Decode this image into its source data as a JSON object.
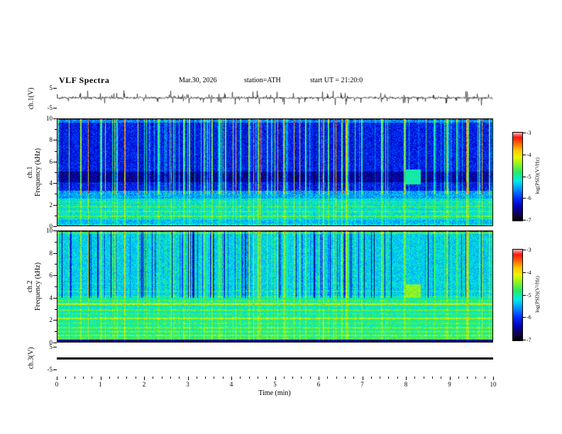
{
  "header": {
    "title": "VLF Spectra",
    "date": "Mar.30, 2026",
    "station": "station=ATH",
    "start_ut": "start UT =  21:20:0"
  },
  "axes": {
    "time": {
      "label": "Time (min)",
      "range": [
        0,
        10
      ],
      "major_ticks": [
        0,
        1,
        2,
        3,
        4,
        5,
        6,
        7,
        8,
        9,
        10
      ]
    },
    "waveform": {
      "label": "ch.1(V)",
      "range": [
        -5,
        5
      ],
      "ticks": [
        5,
        -5
      ]
    },
    "spec1": {
      "label_line1": "ch.1",
      "label_line2": "Frequency (kHz)",
      "range": [
        0,
        10
      ],
      "major_ticks": [
        10,
        8,
        6,
        4,
        2,
        0
      ],
      "minor_ticks": [
        1,
        3,
        5,
        7,
        9
      ]
    },
    "spec2": {
      "label_line1": "ch.2",
      "label_line2": "Frequency (kHz)",
      "range": [
        0,
        10
      ],
      "major_ticks": [
        10,
        8,
        6,
        4,
        2,
        0
      ],
      "minor_ticks": [
        1,
        3,
        5,
        7,
        9
      ]
    },
    "ch3": {
      "label": "ch.3(V)",
      "range": [
        -5,
        5
      ],
      "ticks": [
        5,
        -5
      ]
    }
  },
  "colorbar": {
    "label": "log(PSD)(V²/Hz)",
    "range": [
      -7,
      -3
    ],
    "ticks": [
      -3,
      -4,
      -5,
      -6,
      -7
    ]
  },
  "chart_data": [
    {
      "type": "line",
      "name": "ch1_waveform",
      "ylabel": "ch.1(V)",
      "xlim": [
        0,
        10
      ],
      "ylim": [
        -5,
        5
      ],
      "description": "continuous broadband noise of roughly ±1 V with random impulsive sferic spikes reaching about ±4 V throughout the 10-minute record"
    },
    {
      "type": "heatmap",
      "name": "ch1_spectrogram",
      "xlabel": "Time (min)",
      "ylabel": "ch.1 Frequency (kHz)",
      "xlim": [
        0,
        10
      ],
      "ylim": [
        0,
        10
      ],
      "zlabel": "log(PSD)(V²/Hz)",
      "zlim": [
        -7,
        -3
      ],
      "noise": 0.35,
      "bands": [
        {
          "f": [
            0,
            0.25
          ],
          "level": -6.9
        },
        {
          "f": [
            0.25,
            0.6
          ],
          "level": -5.4
        },
        {
          "f": [
            0.6,
            2.6
          ],
          "level": -5.15
        },
        {
          "f": [
            2.6,
            3.3
          ],
          "level": -5.5
        },
        {
          "f": [
            3.3,
            4.1
          ],
          "level": -6.1
        },
        {
          "f": [
            4.1,
            5.1
          ],
          "level": -6.45
        },
        {
          "f": [
            5.1,
            9.7
          ],
          "level": -6.1
        },
        {
          "f": [
            9.7,
            10
          ],
          "level": -5.6
        }
      ],
      "lines": [
        {
          "f": 0.15,
          "level": -5.0
        },
        {
          "f": 0.9,
          "level": -4.5
        },
        {
          "f": 1.35,
          "level": -4.6
        },
        {
          "f": 1.8,
          "level": -4.7
        },
        {
          "f": 2.25,
          "level": -4.8
        }
      ],
      "texture": {
        "split_f": 3.0,
        "bright_high": 1.05,
        "bright_low": 0.3,
        "dark_high": 0.15,
        "dark_low": 0.05
      },
      "event": {
        "t": [
          8.0,
          8.35
        ],
        "f": [
          3.9,
          5.3
        ],
        "level": -5.0
      },
      "description": "dense vertical sferic streaks (green/yellow) over a blue background above ~3 kHz, darker band 4-5 kHz, green band with horizontal harmonic lines below 2.6 kHz, black strip below 0.25 kHz, transient enhancement near t=8.1 min at 4-5 kHz"
    },
    {
      "type": "heatmap",
      "name": "ch2_spectrogram",
      "xlabel": "Time (min)",
      "ylabel": "ch.2 Frequency (kHz)",
      "xlim": [
        0,
        10
      ],
      "ylim": [
        0,
        10
      ],
      "zlabel": "log(PSD)(V²/Hz)",
      "zlim": [
        -7,
        -3
      ],
      "noise": 0.3,
      "bands": [
        {
          "f": [
            0,
            0.2
          ],
          "level": -6.6
        },
        {
          "f": [
            0.2,
            2.0
          ],
          "level": -4.95
        },
        {
          "f": [
            2.0,
            4.2
          ],
          "level": -5.05
        },
        {
          "f": [
            4.2,
            9.75
          ],
          "level": -5.3
        },
        {
          "f": [
            9.75,
            10
          ],
          "level": -4.8
        }
      ],
      "lines": [
        {
          "f": 0.35,
          "level": -4.5
        },
        {
          "f": 0.6,
          "level": -4.3
        },
        {
          "f": 0.95,
          "level": -4.4
        },
        {
          "f": 1.3,
          "level": -4.35
        },
        {
          "f": 1.7,
          "level": -4.5
        },
        {
          "f": 2.15,
          "level": -4.2
        },
        {
          "f": 2.55,
          "level": -4.6
        },
        {
          "f": 2.9,
          "level": -4.45
        },
        {
          "f": 3.45,
          "level": -4.05
        },
        {
          "f": 3.75,
          "level": -4.55
        },
        {
          "f": 4.6,
          "level": -4.85
        },
        {
          "f": 5.3,
          "level": -5.0
        }
      ],
      "texture": {
        "split_f": 4.0,
        "bright_high": 0.5,
        "bright_low": 0.22,
        "dark_high": 0.8,
        "dark_low": 0.08
      },
      "event": {
        "t": [
          8.0,
          8.35
        ],
        "f": [
          4.0,
          5.2
        ],
        "level": -4.45
      },
      "description": "overall green background with bright yellow/orange horizontal interference lines below ~4 kHz, blue vertical sferic dips and yellow-green columns above 4 kHz, transient enhancement near t=8.1 min at 4-5 kHz"
    },
    {
      "type": "line",
      "name": "ch3_waveform",
      "ylabel": "ch.3(V)",
      "xlim": [
        0,
        10
      ],
      "ylim": [
        -5,
        5
      ],
      "description": "flat thick trace at 0 V for the entire record (channel inactive)"
    }
  ]
}
